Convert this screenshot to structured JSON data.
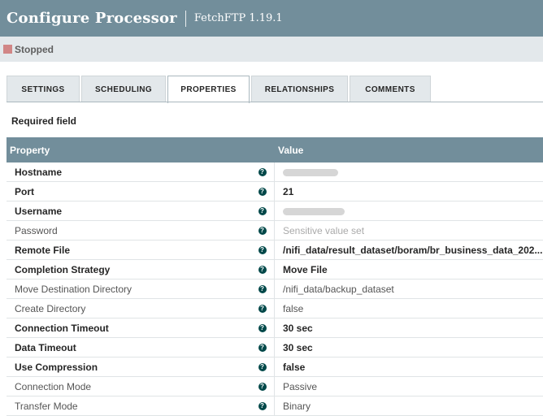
{
  "header": {
    "title": "Configure Processor",
    "subtitle": "FetchFTP 1.19.1"
  },
  "status": {
    "label": "Stopped",
    "color": "#d18686"
  },
  "tabs": [
    {
      "label": "SETTINGS",
      "active": false
    },
    {
      "label": "SCHEDULING",
      "active": false
    },
    {
      "label": "PROPERTIES",
      "active": true
    },
    {
      "label": "RELATIONSHIPS",
      "active": false
    },
    {
      "label": "COMMENTS",
      "active": false
    }
  ],
  "required_field_label": "Required field",
  "table": {
    "columns": {
      "property": "Property",
      "value": "Value"
    },
    "help_glyph": "?",
    "rows": [
      {
        "name": "Hostname",
        "value": "",
        "redacted": true
      },
      {
        "name": "Port",
        "value": "21"
      },
      {
        "name": "Username",
        "value": "",
        "redacted": true
      },
      {
        "name": "Password",
        "value": "Sensitive value set"
      },
      {
        "name": "Remote File",
        "value": "/nifi_data/result_dataset/boram/br_business_data_202..."
      },
      {
        "name": "Completion Strategy",
        "value": "Move File"
      },
      {
        "name": "Move Destination Directory",
        "value": "/nifi_data/backup_dataset"
      },
      {
        "name": "Create Directory",
        "value": "false"
      },
      {
        "name": "Connection Timeout",
        "value": "30 sec"
      },
      {
        "name": "Data Timeout",
        "value": "30 sec"
      },
      {
        "name": "Use Compression",
        "value": "false"
      },
      {
        "name": "Connection Mode",
        "value": "Passive"
      },
      {
        "name": "Transfer Mode",
        "value": "Binary"
      }
    ]
  },
  "colors": {
    "header_bg": "#728e9b",
    "help_icon": "#004849",
    "status_stopped": "#d18686"
  }
}
